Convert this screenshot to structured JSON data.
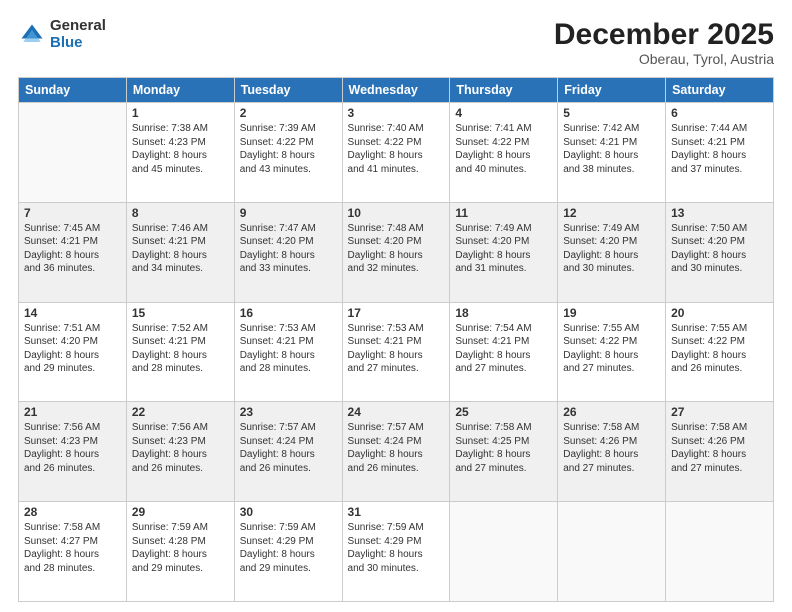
{
  "logo": {
    "general": "General",
    "blue": "Blue"
  },
  "header": {
    "month": "December 2025",
    "location": "Oberau, Tyrol, Austria"
  },
  "weekdays": [
    "Sunday",
    "Monday",
    "Tuesday",
    "Wednesday",
    "Thursday",
    "Friday",
    "Saturday"
  ],
  "weeks": [
    [
      {
        "day": "",
        "info": ""
      },
      {
        "day": "1",
        "info": "Sunrise: 7:38 AM\nSunset: 4:23 PM\nDaylight: 8 hours\nand 45 minutes."
      },
      {
        "day": "2",
        "info": "Sunrise: 7:39 AM\nSunset: 4:22 PM\nDaylight: 8 hours\nand 43 minutes."
      },
      {
        "day": "3",
        "info": "Sunrise: 7:40 AM\nSunset: 4:22 PM\nDaylight: 8 hours\nand 41 minutes."
      },
      {
        "day": "4",
        "info": "Sunrise: 7:41 AM\nSunset: 4:22 PM\nDaylight: 8 hours\nand 40 minutes."
      },
      {
        "day": "5",
        "info": "Sunrise: 7:42 AM\nSunset: 4:21 PM\nDaylight: 8 hours\nand 38 minutes."
      },
      {
        "day": "6",
        "info": "Sunrise: 7:44 AM\nSunset: 4:21 PM\nDaylight: 8 hours\nand 37 minutes."
      }
    ],
    [
      {
        "day": "7",
        "info": "Sunrise: 7:45 AM\nSunset: 4:21 PM\nDaylight: 8 hours\nand 36 minutes."
      },
      {
        "day": "8",
        "info": "Sunrise: 7:46 AM\nSunset: 4:21 PM\nDaylight: 8 hours\nand 34 minutes."
      },
      {
        "day": "9",
        "info": "Sunrise: 7:47 AM\nSunset: 4:20 PM\nDaylight: 8 hours\nand 33 minutes."
      },
      {
        "day": "10",
        "info": "Sunrise: 7:48 AM\nSunset: 4:20 PM\nDaylight: 8 hours\nand 32 minutes."
      },
      {
        "day": "11",
        "info": "Sunrise: 7:49 AM\nSunset: 4:20 PM\nDaylight: 8 hours\nand 31 minutes."
      },
      {
        "day": "12",
        "info": "Sunrise: 7:49 AM\nSunset: 4:20 PM\nDaylight: 8 hours\nand 30 minutes."
      },
      {
        "day": "13",
        "info": "Sunrise: 7:50 AM\nSunset: 4:20 PM\nDaylight: 8 hours\nand 30 minutes."
      }
    ],
    [
      {
        "day": "14",
        "info": "Sunrise: 7:51 AM\nSunset: 4:20 PM\nDaylight: 8 hours\nand 29 minutes."
      },
      {
        "day": "15",
        "info": "Sunrise: 7:52 AM\nSunset: 4:21 PM\nDaylight: 8 hours\nand 28 minutes."
      },
      {
        "day": "16",
        "info": "Sunrise: 7:53 AM\nSunset: 4:21 PM\nDaylight: 8 hours\nand 28 minutes."
      },
      {
        "day": "17",
        "info": "Sunrise: 7:53 AM\nSunset: 4:21 PM\nDaylight: 8 hours\nand 27 minutes."
      },
      {
        "day": "18",
        "info": "Sunrise: 7:54 AM\nSunset: 4:21 PM\nDaylight: 8 hours\nand 27 minutes."
      },
      {
        "day": "19",
        "info": "Sunrise: 7:55 AM\nSunset: 4:22 PM\nDaylight: 8 hours\nand 27 minutes."
      },
      {
        "day": "20",
        "info": "Sunrise: 7:55 AM\nSunset: 4:22 PM\nDaylight: 8 hours\nand 26 minutes."
      }
    ],
    [
      {
        "day": "21",
        "info": "Sunrise: 7:56 AM\nSunset: 4:23 PM\nDaylight: 8 hours\nand 26 minutes."
      },
      {
        "day": "22",
        "info": "Sunrise: 7:56 AM\nSunset: 4:23 PM\nDaylight: 8 hours\nand 26 minutes."
      },
      {
        "day": "23",
        "info": "Sunrise: 7:57 AM\nSunset: 4:24 PM\nDaylight: 8 hours\nand 26 minutes."
      },
      {
        "day": "24",
        "info": "Sunrise: 7:57 AM\nSunset: 4:24 PM\nDaylight: 8 hours\nand 26 minutes."
      },
      {
        "day": "25",
        "info": "Sunrise: 7:58 AM\nSunset: 4:25 PM\nDaylight: 8 hours\nand 27 minutes."
      },
      {
        "day": "26",
        "info": "Sunrise: 7:58 AM\nSunset: 4:26 PM\nDaylight: 8 hours\nand 27 minutes."
      },
      {
        "day": "27",
        "info": "Sunrise: 7:58 AM\nSunset: 4:26 PM\nDaylight: 8 hours\nand 27 minutes."
      }
    ],
    [
      {
        "day": "28",
        "info": "Sunrise: 7:58 AM\nSunset: 4:27 PM\nDaylight: 8 hours\nand 28 minutes."
      },
      {
        "day": "29",
        "info": "Sunrise: 7:59 AM\nSunset: 4:28 PM\nDaylight: 8 hours\nand 29 minutes."
      },
      {
        "day": "30",
        "info": "Sunrise: 7:59 AM\nSunset: 4:29 PM\nDaylight: 8 hours\nand 29 minutes."
      },
      {
        "day": "31",
        "info": "Sunrise: 7:59 AM\nSunset: 4:29 PM\nDaylight: 8 hours\nand 30 minutes."
      },
      {
        "day": "",
        "info": ""
      },
      {
        "day": "",
        "info": ""
      },
      {
        "day": "",
        "info": ""
      }
    ]
  ]
}
